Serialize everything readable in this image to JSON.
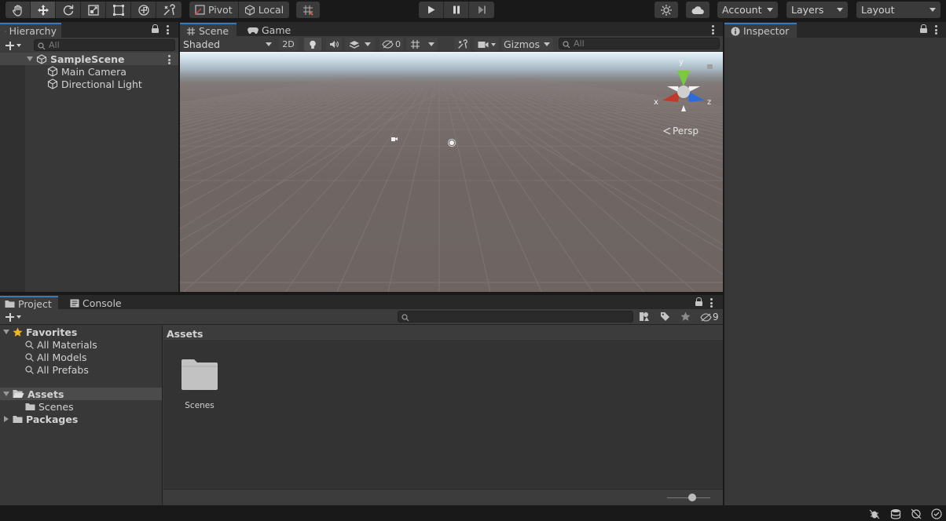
{
  "toolbar": {
    "tools": [
      "hand-tool",
      "move-tool",
      "rotate-tool",
      "scale-tool",
      "rect-tool",
      "transform-tool",
      "custom-tool"
    ],
    "pivot_label": "Pivot",
    "local_label": "Local",
    "account_label": "Account",
    "layers_label": "Layers",
    "layout_label": "Layout"
  },
  "hierarchy": {
    "tab_label": "Hierarchy",
    "search_placeholder": "All",
    "scene_name": "SampleScene",
    "items": [
      "Main Camera",
      "Directional Light"
    ]
  },
  "scene": {
    "tab_scene": "Scene",
    "tab_game": "Game",
    "shading_mode": "Shaded",
    "mode_2d": "2D",
    "hidden_count": "0",
    "gizmos_label": "Gizmos",
    "search_placeholder": "All",
    "axis_x": "x",
    "axis_y": "y",
    "axis_z": "z",
    "projection": "Persp"
  },
  "inspector": {
    "tab_label": "Inspector"
  },
  "project": {
    "tab_project": "Project",
    "tab_console": "Console",
    "hidden_packages_count": "9",
    "favorites_label": "Favorites",
    "favorites": [
      "All Materials",
      "All Models",
      "All Prefabs"
    ],
    "assets_label": "Assets",
    "scenes_label": "Scenes",
    "packages_label": "Packages",
    "assets_header": "Assets",
    "folder_name": "Scenes"
  },
  "colors": {
    "accent": "#3a79bb",
    "panel_bg": "#383838",
    "toolbar_bg": "#191919",
    "gizmo_x": "#c0392b",
    "gizmo_y": "#7ac943",
    "gizmo_z": "#2e6bd8"
  }
}
